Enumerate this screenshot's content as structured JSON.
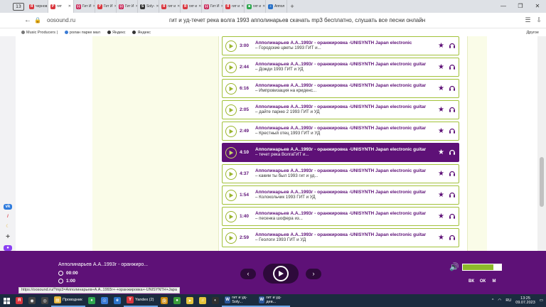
{
  "browser": {
    "tab_count": "13",
    "tabs": [
      {
        "label": "чернов",
        "color": "#d9363e",
        "glyph": "Я"
      },
      {
        "label": "гит",
        "color": "#d9363e",
        "glyph": "P",
        "active": true
      },
      {
        "label": "Гит И",
        "color": "#c4164b",
        "glyph": "Ⓗ"
      },
      {
        "label": "Гит И",
        "color": "#d9363e",
        "glyph": "P"
      },
      {
        "label": "Гит И",
        "color": "#c4164b",
        "glyph": "Ⓗ"
      },
      {
        "label": "Soly-",
        "color": "#333333",
        "glyph": "S"
      },
      {
        "label": "гит и",
        "color": "#d9363e",
        "glyph": "Я"
      },
      {
        "label": "гит и",
        "color": "#d9363e",
        "glyph": "Я"
      },
      {
        "label": "Гит И",
        "color": "#c4164b",
        "glyph": "Ⓗ"
      },
      {
        "label": "гит и",
        "color": "#d9363e",
        "glyph": "Я"
      },
      {
        "label": "гит и",
        "color": "#2fa84f",
        "glyph": "■"
      },
      {
        "label": "Аппол",
        "color": "#2b73c9",
        "glyph": "♪"
      }
    ],
    "url": "oosound.ru",
    "page_title": "гит и уд-течет река волга 1993 апполинарьев скачать mp3 бесплатно, слушать все песни онлайн",
    "bookmarks": [
      "Music Producers |",
      "ролан парке мал",
      "Яндекс",
      "Яндекс"
    ],
    "other_bookmarks": "Другое"
  },
  "tracks": [
    {
      "duration": "3:00",
      "title": "Апполинарьев А.А..1993г - оранжировка -UNISYNTH Japan electronic",
      "subtitle": "– Городские цветы 1993 ГИТ и..."
    },
    {
      "duration": "2:44",
      "title": "Апполинарьев А.А..1993г - оранжировка -UNISYNTH Japan electronic guitar",
      "subtitle": "– Дожди 1993 ГИТ и УД"
    },
    {
      "duration": "6:16",
      "title": "Апполинарьев А.А..1993г - оранжировка -UNISYNTH Japan electronic guitar",
      "subtitle": "– Импровизация на криденс..."
    },
    {
      "duration": "2:05",
      "title": "Апполинарьев А.А..1993г - оранжировка -UNISYNTH Japan electronic guitar",
      "subtitle": "– дайте парню 2 1993 ГИТ и УД"
    },
    {
      "duration": "2:49",
      "title": "Апполинарьев А.А..1993г - оранжировка -UNISYNTH Japan electronic guitar",
      "subtitle": "– Крестный отец 1993 ГИТ и УД"
    },
    {
      "duration": "4:10",
      "title": "Апполинарьев А.А..1993г - оранжировка -UNISYNTH Japan electronic guitar",
      "subtitle": "– течет река ВолгаГИТ и...",
      "active": true
    },
    {
      "duration": "4:37",
      "title": "Апполинарьев А.А..1993г - оранжировка -UNISYNTH Japan electronic guitar",
      "subtitle": "– каким ты был 1993 гит и уд..."
    },
    {
      "duration": "1:54",
      "title": "Апполинарьев А.А..1993г - оранжировка -UNISYNTH Japan electronic guitar",
      "subtitle": "– Колокольчик 1993 ГИТ и УД"
    },
    {
      "duration": "1:40",
      "title": "Апполинарьев А.А..1993г - оранжировка -UNISYNTH Japan electronic guitar",
      "subtitle": "– песенка шофера из..."
    },
    {
      "duration": "2:59",
      "title": "Апполинарьев А.А..1993г - оранжировка -UNISYNTH Japan electronic guitar",
      "subtitle": "– Геологи 1993 ГИТ и УД"
    }
  ],
  "player": {
    "now_playing": "Апполинарьев А.А..1993г - оранжиро...",
    "elapsed": "00:00",
    "total": "1:00",
    "volume_fraction": 0.8,
    "socials": [
      "ВК",
      "ОК",
      "М"
    ]
  },
  "status_url": "https://oosound.ru/?mp3=Апполинарьев+А.А..1993г+-+оранжировка+-UNISYNTH+Japa",
  "taskbar": {
    "items": [
      {
        "label": "",
        "glyph": "Я",
        "color": "#d9363e"
      },
      {
        "label": "",
        "glyph": "◉",
        "color": "#444"
      },
      {
        "label": "",
        "glyph": "◎",
        "color": "#444"
      },
      {
        "label": "Проводник",
        "glyph": "▤",
        "color": "#e4b43c"
      },
      {
        "label": "",
        "glyph": "♦",
        "color": "#2fa84f"
      },
      {
        "label": "",
        "glyph": "☉",
        "color": "#3a7bd5"
      },
      {
        "label": "",
        "glyph": "e",
        "color": "#2b73c9"
      },
      {
        "label": "Yandex (2)",
        "glyph": "Y",
        "color": "#d9363e"
      },
      {
        "label": "",
        "glyph": "Ⓓ",
        "color": "#c8860b"
      },
      {
        "label": "",
        "glyph": "●",
        "color": "#3a9d3a"
      },
      {
        "label": "",
        "glyph": "➤",
        "color": "#e4c43c"
      },
      {
        "label": "",
        "glyph": "♫",
        "color": "#e4c43c"
      },
      {
        "label": "",
        "glyph": "◐",
        "color": "#2f2f2f"
      },
      {
        "label": "гит и уд-Soly...",
        "glyph": "W",
        "color": "#2b579a"
      },
      {
        "label": "гит и уд-дев...",
        "glyph": "W",
        "color": "#2b579a"
      }
    ],
    "lang": "RU",
    "time": "13:25",
    "date": "09.07.2023"
  },
  "colors": {
    "accent": "#5e1177",
    "green": "#9ab52d"
  }
}
